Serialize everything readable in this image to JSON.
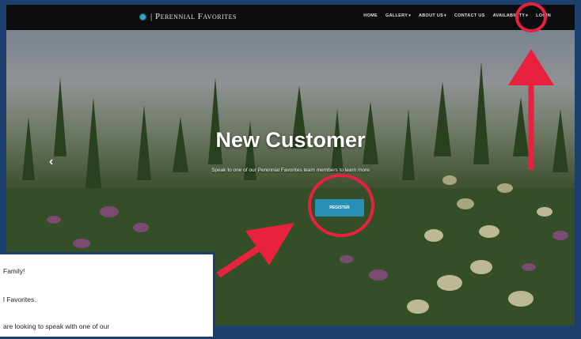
{
  "navbar": {
    "logo_text": "| Perennial Favorites",
    "logo_icon": "flower-icon",
    "items": [
      {
        "label": "HOME",
        "dropdown": false
      },
      {
        "label": "GALLERY",
        "dropdown": true
      },
      {
        "label": "ABOUT US",
        "dropdown": true
      },
      {
        "label": "CONTACT US",
        "dropdown": false
      },
      {
        "label": "AVAILABILITY",
        "dropdown": true
      },
      {
        "label": "LOGIN",
        "dropdown": false
      }
    ]
  },
  "hero": {
    "title": "New Customer",
    "subtitle": "Speak to one of our Perennial Favorites team members to learn more",
    "cta_label": "REGISTER",
    "prev_icon": "chevron-left-icon"
  },
  "panel": {
    "lines": [
      "Family!",
      "l Favorites.",
      "are looking to speak with one of our"
    ]
  },
  "colors": {
    "navbar_bg": "#0c0d0f",
    "cta_bg": "#2a8fb4",
    "annotation_red": "#e8213f",
    "border_blue": "#1c3f6e"
  }
}
